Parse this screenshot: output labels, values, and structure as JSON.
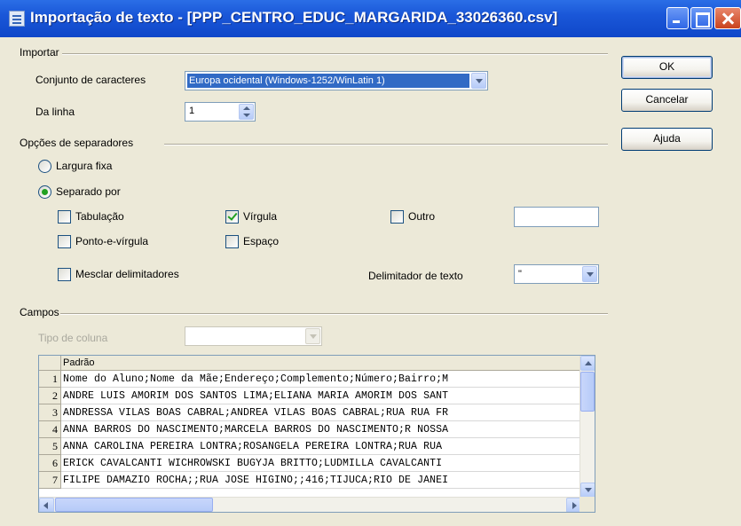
{
  "window": {
    "title": "Importação de texto - [PPP_CENTRO_EDUC_MARGARIDA_33026360.csv]"
  },
  "import": {
    "group_title": "Importar",
    "charset_label": "Conjunto de caracteres",
    "charset_value": "Europa ocidental (Windows-1252/WinLatin 1)",
    "from_row_label": "Da linha",
    "from_row_value": "1"
  },
  "separators": {
    "group_title": "Opções de separadores",
    "fixed_width_label": "Largura fixa",
    "separated_by_label": "Separado por",
    "tab_label": "Tabulação",
    "comma_label": "Vírgula",
    "other_label": "Outro",
    "other_value": "",
    "semicolon_label": "Ponto-e-vírgula",
    "space_label": "Espaço",
    "merge_label": "Mesclar delimitadores",
    "text_delimiter_label": "Delimitador de texto",
    "text_delimiter_value": "\"",
    "state": {
      "fixed_width": false,
      "separated_by": true,
      "tab": false,
      "comma": true,
      "other": false,
      "semicolon": false,
      "space": false,
      "merge": false
    }
  },
  "fields": {
    "group_title": "Campos",
    "column_type_label": "Tipo de coluna",
    "column_type_value": "",
    "header": "Padrão",
    "rows": [
      {
        "num": "1",
        "text": "Nome do Aluno;Nome da Mãe;Endereço;Complemento;Número;Bairro;M"
      },
      {
        "num": "2",
        "text": "ANDRE LUIS AMORIM DOS SANTOS LIMA;ELIANA MARIA AMORIM DOS SANT"
      },
      {
        "num": "3",
        "text": "ANDRESSA VILAS BOAS CABRAL;ANDREA VILAS BOAS CABRAL;RUA RUA FR"
      },
      {
        "num": "4",
        "text": "ANNA BARROS DO NASCIMENTO;MARCELA BARROS DO NASCIMENTO;R NOSSA"
      },
      {
        "num": "5",
        "text": "ANNA CAROLINA PEREIRA LONTRA;ROSANGELA PEREIRA LONTRA;RUA RUA"
      },
      {
        "num": "6",
        "text": "ERICK CAVALCANTI WICHROWSKI BUGYJA BRITTO;LUDMILLA CAVALCANTI"
      },
      {
        "num": "7",
        "text": "FILIPE DAMAZIO ROCHA;;RUA JOSE HIGINO;;416;TIJUCA;RIO DE JANEI"
      }
    ]
  },
  "buttons": {
    "ok": "OK",
    "cancel": "Cancelar",
    "help": "Ajuda"
  }
}
